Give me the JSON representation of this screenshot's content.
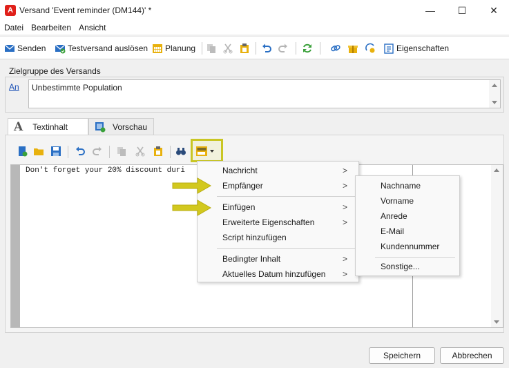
{
  "window": {
    "title": "Versand 'Event reminder (DM144)' *",
    "app_icon_letter": "A",
    "controls": {
      "minimize": "—",
      "maximize": "☐",
      "close": "✕"
    }
  },
  "menubar": {
    "items": [
      "Datei",
      "Bearbeiten",
      "Ansicht"
    ]
  },
  "toolbar": {
    "send": "Senden",
    "test_send": "Testversand auslösen",
    "planning": "Planung",
    "properties": "Eigenschaften"
  },
  "target_group": {
    "label": "Zielgruppe des Versands",
    "to_link": "An",
    "population": "Unbestimmte Population"
  },
  "tabs": {
    "text_content": "Textinhalt",
    "text_icon": "A",
    "preview": "Vorschau"
  },
  "editor": {
    "content": "Don't forget your 20% discount duri"
  },
  "context_menu": {
    "items": [
      {
        "label": "Nachricht",
        "submenu": true
      },
      {
        "label": "Empfänger",
        "submenu": true
      },
      {
        "label": "Einfügen",
        "submenu": true
      },
      {
        "label": "Erweiterte Eigenschaften",
        "submenu": true
      },
      {
        "label": "Script hinzufügen",
        "submenu": false
      },
      {
        "label": "Bedingter Inhalt",
        "submenu": true
      },
      {
        "label": "Aktuelles Datum hinzufügen",
        "submenu": true
      }
    ],
    "arrow_glyph": ">"
  },
  "submenu": {
    "items": [
      "Nachname",
      "Vorname",
      "Anrede",
      "E-Mail",
      "Kundennummer",
      "Sonstige..."
    ]
  },
  "buttons": {
    "save": "Speichern",
    "cancel": "Abbrechen"
  },
  "colors": {
    "accent_blue": "#1a5fb4",
    "highlight_yellow": "#c9c624",
    "arrow_yellow": "#d2c81e",
    "app_red": "#e0201a"
  }
}
